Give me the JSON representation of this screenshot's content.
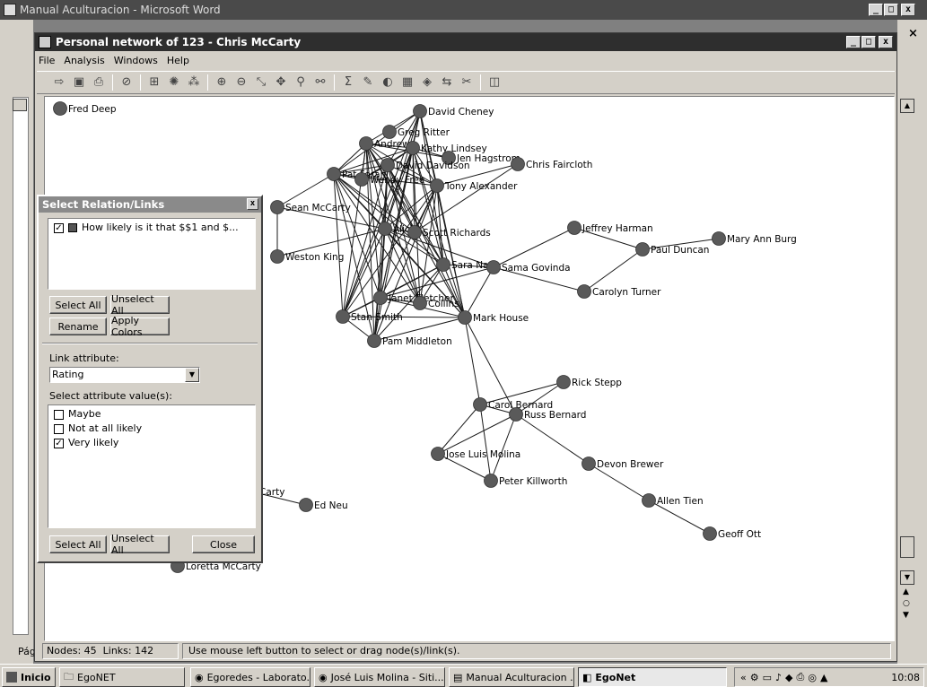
{
  "word_window": {
    "title": "Manual Aculturacion - Microsoft Word",
    "status_left": "Pág"
  },
  "egonet_window": {
    "title": "Personal network of 123 - Chris McCarty",
    "menu": [
      "File",
      "Analysis",
      "Windows",
      "Help"
    ],
    "status": {
      "nodes": "Nodes: 45",
      "links": "Links: 142",
      "hint": "Use mouse left button to select or drag node(s)/link(s)."
    }
  },
  "toolbar_icons": [
    "export-icon",
    "save-icon",
    "print-icon",
    "stop-icon",
    "layout-icon",
    "circle-layout-icon",
    "cluster-icon",
    "zoom-in-icon",
    "zoom-out-icon",
    "edit-link-icon",
    "move-icon",
    "find-icon",
    "find-all-icon",
    "sum-icon",
    "draw-icon",
    "color-icon",
    "grid-icon",
    "shape-icon",
    "arrange-icon",
    "scissors-icon",
    "window-icon"
  ],
  "dialog": {
    "title": "Select Relation/Links",
    "relation_item": "How likely is it that $$1 and $...",
    "buttons": {
      "select_all": "Select All",
      "unselect_all": "Unselect All",
      "rename": "Rename",
      "apply_colors": "Apply Colors",
      "select_all_2": "Select All",
      "unselect_all_2": "Unselect All",
      "close": "Close"
    },
    "link_attribute_label": "Link attribute:",
    "link_attribute_value": "Rating",
    "select_values_label": "Select attribute value(s):",
    "values": [
      {
        "label": "Maybe",
        "checked": false
      },
      {
        "label": "Not at all likely",
        "checked": false
      },
      {
        "label": "Very likely",
        "checked": true
      }
    ]
  },
  "network": {
    "nodes": [
      "Fred Deep",
      "David Cheney",
      "Greg Ritter",
      "Andrew",
      "Kathy Lindsey",
      "Jen Hagstrom",
      "David Davidson",
      "Chris Faircloth",
      "Pat Foran",
      "Wendy Free",
      "Tony Alexander",
      "Sean McCarty",
      "Alicia",
      "Scott Richards",
      "Jeffrey Harman",
      "Paul Duncan",
      "Mary Ann Burg",
      "Weston King",
      "Sara Nash",
      "Sama Govinda",
      "Carolyn Turner",
      "Janet Fletcher",
      "Collins",
      "Stan Smith",
      "Mark House",
      "Pam Middleton",
      "Rick Stepp",
      "Carol Bernard",
      "Russ Bernard",
      "Jose Luis Molina",
      "Devon Brewer",
      "Peter Killworth",
      "Allen Tien",
      "Geoff Ott",
      "Carty",
      "Ed Neu",
      "Loretta McCarty"
    ]
  },
  "taskbar": {
    "start": "Inicio",
    "items": [
      "EgoNET",
      "Egoredes - Laborato...",
      "José Luis Molina - Siti...",
      "Manual Aculturacion ...",
      "EgoNet"
    ],
    "clock": "10:08"
  }
}
